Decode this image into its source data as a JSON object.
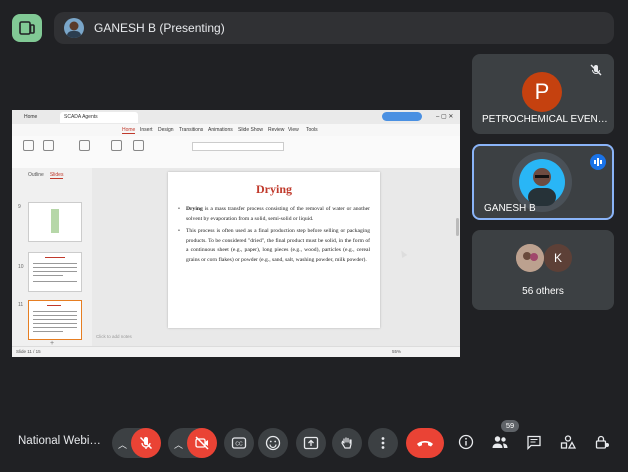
{
  "presenter_chip": {
    "label": "GANESH B (Presenting)"
  },
  "presentation": {
    "window_tabs": [
      "Home",
      "SCADA Agents"
    ],
    "menu": [
      "Home",
      "Insert",
      "Design",
      "Transitions",
      "Animations",
      "Slide Show",
      "Review",
      "View",
      "Tools"
    ],
    "active_menu": "Home",
    "thumb_tabs": {
      "outline": "Outline",
      "slides": "Slides"
    },
    "thumb_numbers": [
      "9",
      "10",
      "11"
    ],
    "slide": {
      "title": "Drying",
      "bullet1_bold": "Drying",
      "bullet1_rest": " is a mass transfer process consisting of the removal of water or another solvent by evaporation from a solid, semi-solid or liquid.",
      "bullet2": "This process is often used as a final production step before selling or packaging products. To be considered \"dried\", the final product must be solid, in the form of a continuous sheet (e.g., paper), long pieces (e.g., wood), particles (e.g., cereal grains or corn flakes) or powder (e.g., sand, salt, washing powder, milk powder)."
    },
    "notes_placeholder": "Click to add notes",
    "status_left": "Slide 11 / 15",
    "status_zoom": "55%"
  },
  "participants": [
    {
      "initial": "P",
      "name": "PETROCHEMICAL EVEN…",
      "avatar_color": "#c5410f",
      "muted": true
    },
    {
      "name": "GANESH B",
      "speaking": true
    },
    {
      "initial": "K",
      "label": "56 others",
      "avatar_color": "#5d4037"
    }
  ],
  "bottom": {
    "meeting_name": "National Webi…",
    "people_count": "59"
  },
  "colors": {
    "bg": "#202124",
    "tile": "#3c4043",
    "red": "#ea4335",
    "accent": "#8ab4f8",
    "logo": "#81c995"
  }
}
